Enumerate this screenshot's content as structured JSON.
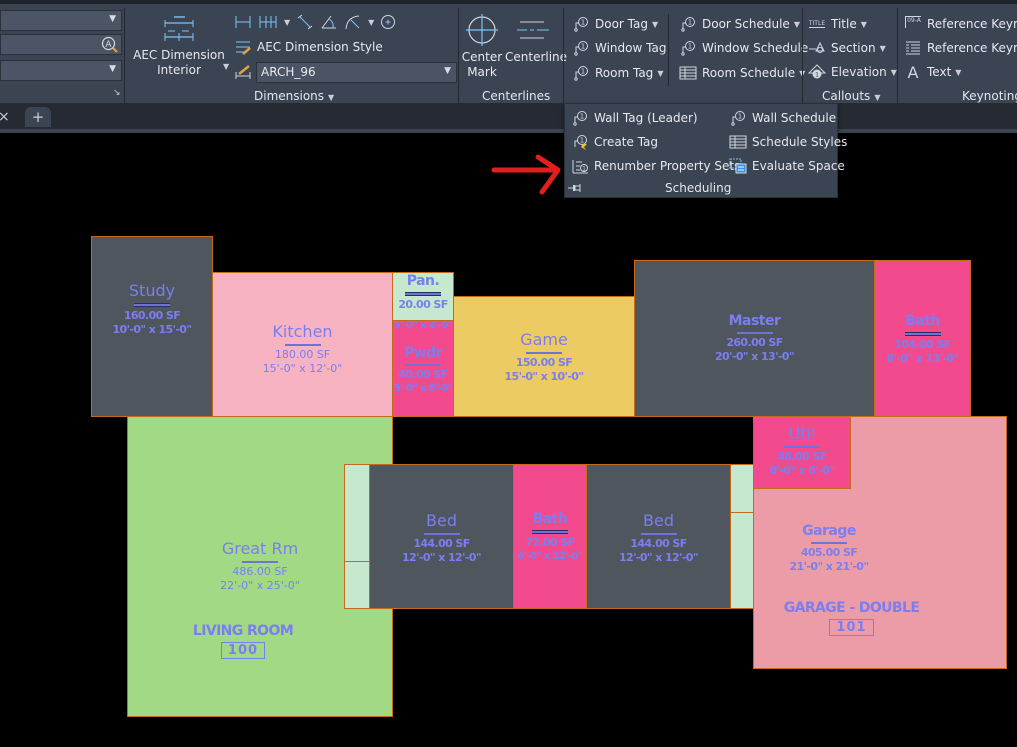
{
  "ribbon": {
    "left_panel": {
      "corner_arrow": "↘"
    },
    "dimensions": {
      "big_button_label_line1": "AEC Dimension",
      "big_button_label_line2": "Interior",
      "dim_style_label": "AEC Dimension Style",
      "dim_style_value": "ARCH_96",
      "panel_title": "Dimensions"
    },
    "centerlines": {
      "center_mark_line1": "Center",
      "center_mark_line2": "Mark",
      "centerline_label": "Centerline",
      "panel_title": "Centerlines"
    },
    "scheduling": {
      "door_tag": "Door Tag",
      "window_tag": "Window Tag",
      "room_tag": "Room Tag",
      "door_schedule": "Door Schedule",
      "window_schedule": "Window Schedule",
      "room_schedule": "Room Schedule"
    },
    "callouts": {
      "title": "Title",
      "section": "Section",
      "elevation": "Elevation",
      "panel_title": "Callouts",
      "title_icon_text": "TITLE"
    },
    "keynoting": {
      "ref_keynote_1": "Reference Keynote",
      "ref_keynote_2": "Reference Keynote",
      "text": "Text",
      "panel_title": "Keynoting",
      "keynote_icon_text": "09-A"
    }
  },
  "scheduling_dropdown": {
    "items_left": [
      "Wall Tag (Leader)",
      "Create Tag",
      "Renumber Property Sets"
    ],
    "items_right": [
      "Wall Schedule",
      "Schedule Styles",
      "Evaluate Space"
    ],
    "panel_title": "Scheduling"
  },
  "tabbar": {
    "close_glyph": "×",
    "add_glyph": "+"
  },
  "colors": {
    "room_gray": "#50565e",
    "room_pink_light": "#f7b3c2",
    "room_pink_hot": "#f24a8d",
    "room_green_light": "#c5e8cf",
    "room_green": "#a2d985",
    "room_yellow": "#eccb62",
    "room_rose": "#ec9ca6",
    "label_blue": "#7b7ef0",
    "wall_orange": "#c46a1a",
    "arrow_red": "#e01f1f"
  },
  "rooms": {
    "study": {
      "name": "Study",
      "area": "160.00 SF",
      "dims": "10'-0\" x 15'-0\""
    },
    "kitchen": {
      "name": "Kitchen",
      "area": "180.00 SF",
      "dims": "15'-0\" x 12'-0\""
    },
    "pan": {
      "name": "Pan.",
      "area": "20.00 SF",
      "dims": "5'-0\" x 4'-0\""
    },
    "pwdr": {
      "name": "Pwdr",
      "area": "40.00 SF",
      "dims": "5'-0\" x 8'-0\""
    },
    "game": {
      "name": "Game",
      "area": "150.00 SF",
      "dims": "15'-0\" x 10'-0\""
    },
    "master": {
      "name": "Master",
      "area": "260.00 SF",
      "dims": "20'-0\" x 13'-0\""
    },
    "master_bath": {
      "name": "Bath",
      "area": "104.00 SF",
      "dims": "8'-0\" x 13'-0\""
    },
    "great_rm": {
      "name": "Great Rm",
      "area": "486.00 SF",
      "dims": "22'-0\" x 25'-0\"",
      "tag": "LIVING ROOM",
      "tag_number": "100"
    },
    "bed1": {
      "name": "Bed",
      "area": "144.00 SF",
      "dims": "12'-0\" x 12'-0\""
    },
    "bath2": {
      "name": "Bath",
      "area": "72.00 SF",
      "dims": "6'-0\" x 12'-0\""
    },
    "bed2": {
      "name": "Bed",
      "area": "144.00 SF",
      "dims": "12'-0\" x 12'-0\""
    },
    "util": {
      "name": "Util",
      "area": "48.00 SF",
      "dims": "8'-0\" x 6'-0\""
    },
    "garage": {
      "name": "Garage",
      "area": "405.00 SF",
      "dims": "21'-0\" x 21'-0\"",
      "tag": "GARAGE - DOUBLE",
      "tag_number": "101"
    }
  }
}
